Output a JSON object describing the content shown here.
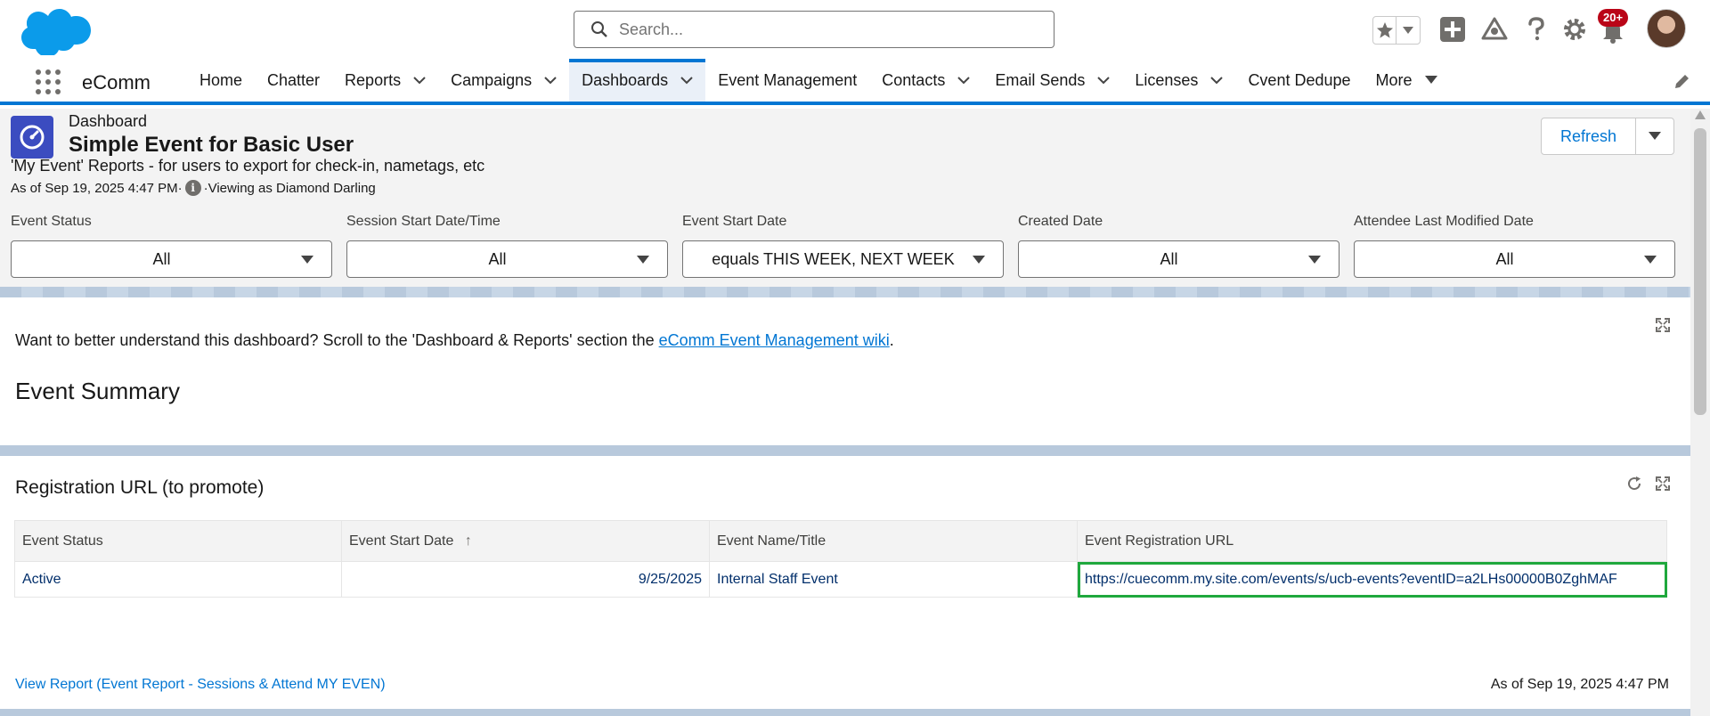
{
  "search": {
    "placeholder": "Search..."
  },
  "header": {
    "notification_count": "20+"
  },
  "nav": {
    "app_name": "eComm",
    "items": [
      {
        "label": "Home",
        "dropdown": false,
        "active": false
      },
      {
        "label": "Chatter",
        "dropdown": false,
        "active": false
      },
      {
        "label": "Reports",
        "dropdown": true,
        "active": false
      },
      {
        "label": "Campaigns",
        "dropdown": true,
        "active": false
      },
      {
        "label": "Dashboards",
        "dropdown": true,
        "active": true
      },
      {
        "label": "Event Management",
        "dropdown": false,
        "active": false
      },
      {
        "label": "Contacts",
        "dropdown": true,
        "active": false
      },
      {
        "label": "Email Sends",
        "dropdown": true,
        "active": false
      },
      {
        "label": "Licenses",
        "dropdown": true,
        "active": false
      },
      {
        "label": "Cvent Dedupe",
        "dropdown": false,
        "active": false
      },
      {
        "label": "More",
        "dropdown": true,
        "active": false
      }
    ]
  },
  "dashboard": {
    "type_label": "Dashboard",
    "title": "Simple Event for Basic User",
    "description": "'My Event' Reports - for users to export for check-in, nametags, etc",
    "as_of": "As of Sep 19, 2025 4:47 PM·",
    "viewing_as": "·Viewing as Diamond Darling",
    "refresh_label": "Refresh"
  },
  "filters": [
    {
      "label": "Event Status",
      "value": "All"
    },
    {
      "label": "Session Start Date/Time",
      "value": "All"
    },
    {
      "label": "Event Start Date",
      "value": "equals THIS WEEK, NEXT WEEK"
    },
    {
      "label": "Created Date",
      "value": "All"
    },
    {
      "label": "Attendee Last Modified Date",
      "value": "All"
    }
  ],
  "summary_card": {
    "intro_text": "Want to better understand this dashboard? Scroll to the 'Dashboard & Reports' section the ",
    "intro_link": "eComm Event Management wiki",
    "intro_end": ".",
    "heading": "Event Summary"
  },
  "registration_card": {
    "title": "Registration URL (to promote)",
    "columns": [
      "Event Status",
      "Event Start Date",
      "Event Name/Title",
      "Event Registration URL"
    ],
    "sort_indicator": "↑",
    "rows": [
      [
        "Active",
        "9/25/2025",
        "Internal Staff Event",
        "https://cuecomm.my.site.com/events/s/ucb-events?eventID=a2LHs00000B0ZghMAF"
      ]
    ],
    "view_report": "View Report (Event Report - Sessions & Attend MY EVEN)",
    "as_of": "As of Sep 19, 2025 4:47 PM"
  },
  "colors": {
    "brand": "#0176d3",
    "highlight": "#1fa83d",
    "dashboard_icon": "#3b4cc0"
  }
}
